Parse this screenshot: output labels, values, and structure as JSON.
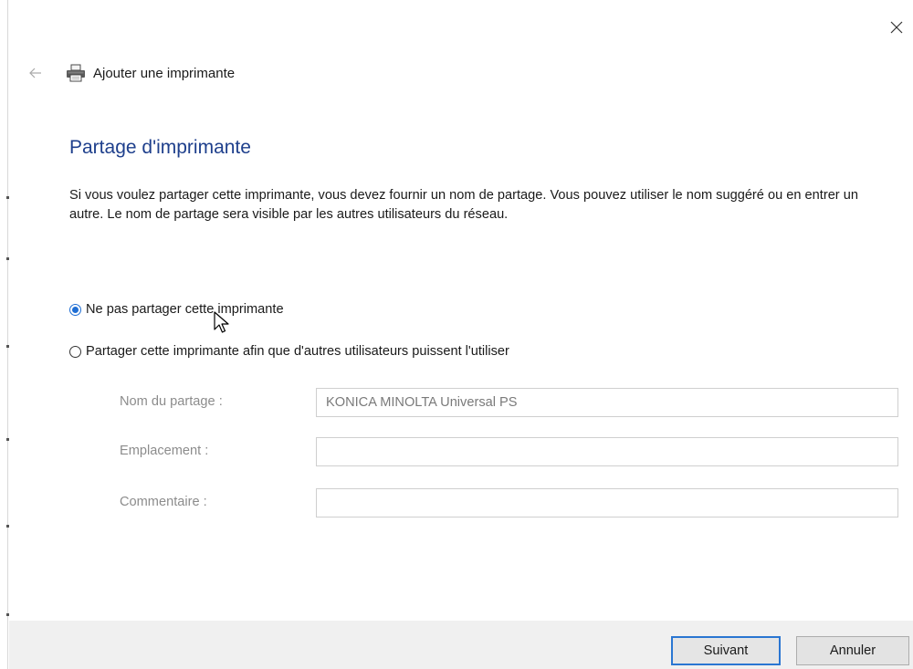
{
  "window": {
    "close_icon": "close-icon"
  },
  "header": {
    "back_icon": "back-arrow-icon",
    "printer_icon": "printer-icon",
    "title": "Ajouter une imprimante"
  },
  "page": {
    "heading": "Partage d'imprimante",
    "description": "Si vous voulez partager cette imprimante, vous devez fournir un nom de partage. Vous pouvez utiliser le nom suggéré ou en entrer un autre. Le nom de partage sera visible par les autres utilisateurs du réseau."
  },
  "options": {
    "no_share_label": "Ne pas partager cette imprimante",
    "share_label": "Partager cette imprimante afin que d'autres utilisateurs puissent l'utiliser",
    "selected": "no_share"
  },
  "fields": {
    "share_name_label": "Nom du partage :",
    "share_name_value": "KONICA MINOLTA Universal PS",
    "location_label": "Emplacement :",
    "location_value": "",
    "comment_label": "Commentaire :",
    "comment_value": ""
  },
  "footer": {
    "next_label": "Suivant",
    "cancel_label": "Annuler"
  },
  "colors": {
    "heading": "#1e3f8c",
    "accent": "#1f6ed4",
    "footer_bg": "#f0f0f0",
    "disabled_text": "#8c8c8c"
  }
}
